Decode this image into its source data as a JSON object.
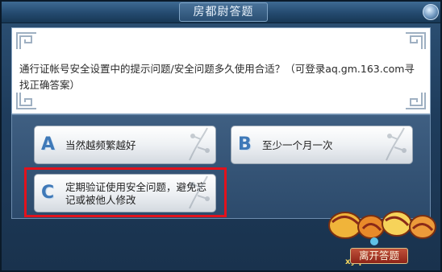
{
  "window": {
    "title": "房都尉答题"
  },
  "question": {
    "text": "通行证帐号安全设置中的提示问题/安全问题多久使用合适？（可登录aq.gm.163.com寻找正确答案）"
  },
  "answers": [
    {
      "letter": "A",
      "text": "当然越频繁越好"
    },
    {
      "letter": "B",
      "text": "至少一个月一次"
    },
    {
      "letter": "C",
      "text": "定期验证使用安全问题，避免忘记或被他人修改"
    }
  ],
  "footer": {
    "leave_label": "离开答题",
    "logo_domain": "xyq.163.com"
  },
  "colors": {
    "highlight": "#e2121c",
    "letter": "#3f79b8"
  }
}
